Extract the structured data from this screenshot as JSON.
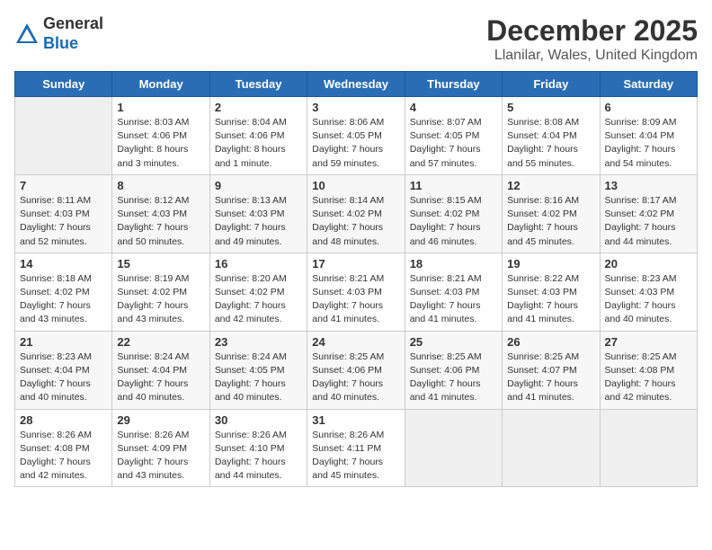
{
  "header": {
    "logo_line1": "General",
    "logo_line2": "Blue",
    "month": "December 2025",
    "location": "Llanilar, Wales, United Kingdom"
  },
  "days_of_week": [
    "Sunday",
    "Monday",
    "Tuesday",
    "Wednesday",
    "Thursday",
    "Friday",
    "Saturday"
  ],
  "weeks": [
    [
      {
        "num": "",
        "sunrise": "",
        "sunset": "",
        "daylight": ""
      },
      {
        "num": "1",
        "sunrise": "Sunrise: 8:03 AM",
        "sunset": "Sunset: 4:06 PM",
        "daylight": "Daylight: 8 hours and 3 minutes."
      },
      {
        "num": "2",
        "sunrise": "Sunrise: 8:04 AM",
        "sunset": "Sunset: 4:06 PM",
        "daylight": "Daylight: 8 hours and 1 minute."
      },
      {
        "num": "3",
        "sunrise": "Sunrise: 8:06 AM",
        "sunset": "Sunset: 4:05 PM",
        "daylight": "Daylight: 7 hours and 59 minutes."
      },
      {
        "num": "4",
        "sunrise": "Sunrise: 8:07 AM",
        "sunset": "Sunset: 4:05 PM",
        "daylight": "Daylight: 7 hours and 57 minutes."
      },
      {
        "num": "5",
        "sunrise": "Sunrise: 8:08 AM",
        "sunset": "Sunset: 4:04 PM",
        "daylight": "Daylight: 7 hours and 55 minutes."
      },
      {
        "num": "6",
        "sunrise": "Sunrise: 8:09 AM",
        "sunset": "Sunset: 4:04 PM",
        "daylight": "Daylight: 7 hours and 54 minutes."
      }
    ],
    [
      {
        "num": "7",
        "sunrise": "Sunrise: 8:11 AM",
        "sunset": "Sunset: 4:03 PM",
        "daylight": "Daylight: 7 hours and 52 minutes."
      },
      {
        "num": "8",
        "sunrise": "Sunrise: 8:12 AM",
        "sunset": "Sunset: 4:03 PM",
        "daylight": "Daylight: 7 hours and 50 minutes."
      },
      {
        "num": "9",
        "sunrise": "Sunrise: 8:13 AM",
        "sunset": "Sunset: 4:03 PM",
        "daylight": "Daylight: 7 hours and 49 minutes."
      },
      {
        "num": "10",
        "sunrise": "Sunrise: 8:14 AM",
        "sunset": "Sunset: 4:02 PM",
        "daylight": "Daylight: 7 hours and 48 minutes."
      },
      {
        "num": "11",
        "sunrise": "Sunrise: 8:15 AM",
        "sunset": "Sunset: 4:02 PM",
        "daylight": "Daylight: 7 hours and 46 minutes."
      },
      {
        "num": "12",
        "sunrise": "Sunrise: 8:16 AM",
        "sunset": "Sunset: 4:02 PM",
        "daylight": "Daylight: 7 hours and 45 minutes."
      },
      {
        "num": "13",
        "sunrise": "Sunrise: 8:17 AM",
        "sunset": "Sunset: 4:02 PM",
        "daylight": "Daylight: 7 hours and 44 minutes."
      }
    ],
    [
      {
        "num": "14",
        "sunrise": "Sunrise: 8:18 AM",
        "sunset": "Sunset: 4:02 PM",
        "daylight": "Daylight: 7 hours and 43 minutes."
      },
      {
        "num": "15",
        "sunrise": "Sunrise: 8:19 AM",
        "sunset": "Sunset: 4:02 PM",
        "daylight": "Daylight: 7 hours and 43 minutes."
      },
      {
        "num": "16",
        "sunrise": "Sunrise: 8:20 AM",
        "sunset": "Sunset: 4:02 PM",
        "daylight": "Daylight: 7 hours and 42 minutes."
      },
      {
        "num": "17",
        "sunrise": "Sunrise: 8:21 AM",
        "sunset": "Sunset: 4:03 PM",
        "daylight": "Daylight: 7 hours and 41 minutes."
      },
      {
        "num": "18",
        "sunrise": "Sunrise: 8:21 AM",
        "sunset": "Sunset: 4:03 PM",
        "daylight": "Daylight: 7 hours and 41 minutes."
      },
      {
        "num": "19",
        "sunrise": "Sunrise: 8:22 AM",
        "sunset": "Sunset: 4:03 PM",
        "daylight": "Daylight: 7 hours and 41 minutes."
      },
      {
        "num": "20",
        "sunrise": "Sunrise: 8:23 AM",
        "sunset": "Sunset: 4:03 PM",
        "daylight": "Daylight: 7 hours and 40 minutes."
      }
    ],
    [
      {
        "num": "21",
        "sunrise": "Sunrise: 8:23 AM",
        "sunset": "Sunset: 4:04 PM",
        "daylight": "Daylight: 7 hours and 40 minutes."
      },
      {
        "num": "22",
        "sunrise": "Sunrise: 8:24 AM",
        "sunset": "Sunset: 4:04 PM",
        "daylight": "Daylight: 7 hours and 40 minutes."
      },
      {
        "num": "23",
        "sunrise": "Sunrise: 8:24 AM",
        "sunset": "Sunset: 4:05 PM",
        "daylight": "Daylight: 7 hours and 40 minutes."
      },
      {
        "num": "24",
        "sunrise": "Sunrise: 8:25 AM",
        "sunset": "Sunset: 4:06 PM",
        "daylight": "Daylight: 7 hours and 40 minutes."
      },
      {
        "num": "25",
        "sunrise": "Sunrise: 8:25 AM",
        "sunset": "Sunset: 4:06 PM",
        "daylight": "Daylight: 7 hours and 41 minutes."
      },
      {
        "num": "26",
        "sunrise": "Sunrise: 8:25 AM",
        "sunset": "Sunset: 4:07 PM",
        "daylight": "Daylight: 7 hours and 41 minutes."
      },
      {
        "num": "27",
        "sunrise": "Sunrise: 8:25 AM",
        "sunset": "Sunset: 4:08 PM",
        "daylight": "Daylight: 7 hours and 42 minutes."
      }
    ],
    [
      {
        "num": "28",
        "sunrise": "Sunrise: 8:26 AM",
        "sunset": "Sunset: 4:08 PM",
        "daylight": "Daylight: 7 hours and 42 minutes."
      },
      {
        "num": "29",
        "sunrise": "Sunrise: 8:26 AM",
        "sunset": "Sunset: 4:09 PM",
        "daylight": "Daylight: 7 hours and 43 minutes."
      },
      {
        "num": "30",
        "sunrise": "Sunrise: 8:26 AM",
        "sunset": "Sunset: 4:10 PM",
        "daylight": "Daylight: 7 hours and 44 minutes."
      },
      {
        "num": "31",
        "sunrise": "Sunrise: 8:26 AM",
        "sunset": "Sunset: 4:11 PM",
        "daylight": "Daylight: 7 hours and 45 minutes."
      },
      {
        "num": "",
        "sunrise": "",
        "sunset": "",
        "daylight": ""
      },
      {
        "num": "",
        "sunrise": "",
        "sunset": "",
        "daylight": ""
      },
      {
        "num": "",
        "sunrise": "",
        "sunset": "",
        "daylight": ""
      }
    ]
  ]
}
